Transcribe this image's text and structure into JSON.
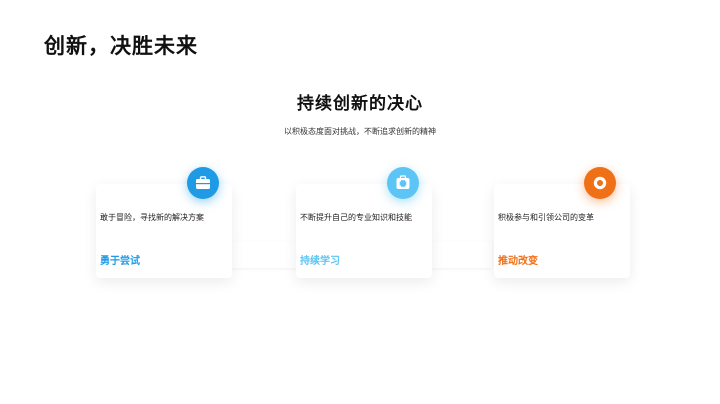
{
  "slide": {
    "title": "创新，决胜未来"
  },
  "section": {
    "heading": "持续创新的决心",
    "subheading": "以积极态度面对挑战，不断追求创新的精神"
  },
  "cards": [
    {
      "description": "敢于冒险，寻找新的解决方案",
      "label": "勇于尝试",
      "accent": "#1f9be6",
      "icon": "briefcase-icon"
    },
    {
      "description": "不断提升自己的专业知识和技能",
      "label": "持续学习",
      "accent": "#5cc5f5",
      "icon": "medical-kit-icon"
    },
    {
      "description": "积极参与和引领公司的变革",
      "label": "推动改变",
      "accent": "#f07018",
      "icon": "target-icon"
    }
  ]
}
